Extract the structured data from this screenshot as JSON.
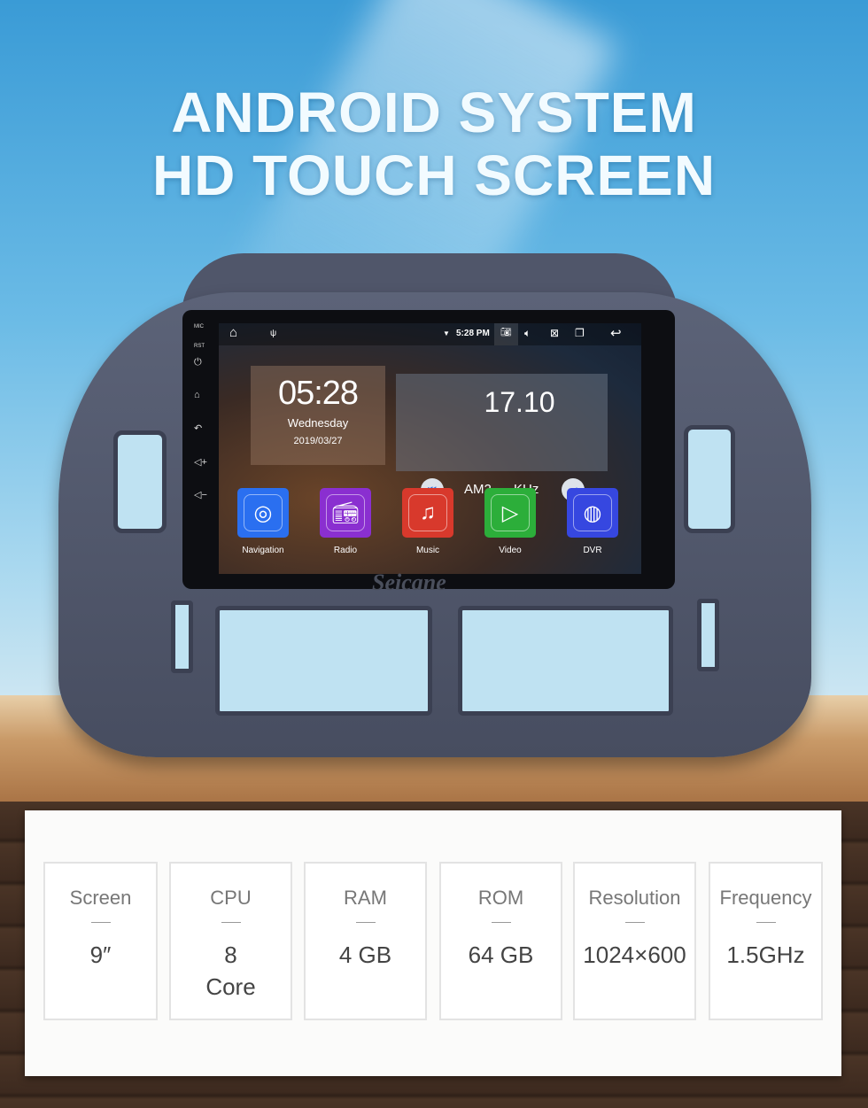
{
  "headline": {
    "line1": "ANDROID SYSTEM",
    "line2": "HD TOUCH SCREEN"
  },
  "brand": "Seicane",
  "device": {
    "side_buttons": {
      "mic": "MIC",
      "rst": "RST",
      "icons": [
        "power-icon",
        "home-icon",
        "back-icon",
        "volume-up-icon",
        "volume-down-icon"
      ]
    },
    "status_bar": {
      "time": "5:28 PM",
      "icons": [
        "home-icon",
        "usb-icon",
        "wifi-icon",
        "camera-icon",
        "volume-icon",
        "close-window-icon",
        "recent-apps-icon",
        "back-icon"
      ]
    },
    "clock": {
      "time": "05:28",
      "day": "Wednesday",
      "date": "2019/03/27"
    },
    "radio": {
      "frequency": "17.10",
      "band": "AM2",
      "unit": "KHz"
    },
    "apps": [
      {
        "label": "Navigation",
        "color": "#2a6ff0",
        "icon": "navigation-icon"
      },
      {
        "label": "Radio",
        "color": "#8a2fd0",
        "icon": "radio-icon"
      },
      {
        "label": "Music",
        "color": "#d8392c",
        "icon": "music-icon"
      },
      {
        "label": "Video",
        "color": "#2cae3a",
        "icon": "video-icon"
      },
      {
        "label": "DVR",
        "color": "#3647e0",
        "icon": "dvr-icon"
      }
    ]
  },
  "specs": [
    {
      "label": "Screen",
      "value": "9″"
    },
    {
      "label": "CPU",
      "value": "8 Core"
    },
    {
      "label": "RAM",
      "value": "4 GB"
    },
    {
      "label": "ROM",
      "value": "64 GB"
    },
    {
      "label": "Resolution",
      "value": "1024×600"
    },
    {
      "label": "Frequency",
      "value": "1.5GHz"
    }
  ]
}
